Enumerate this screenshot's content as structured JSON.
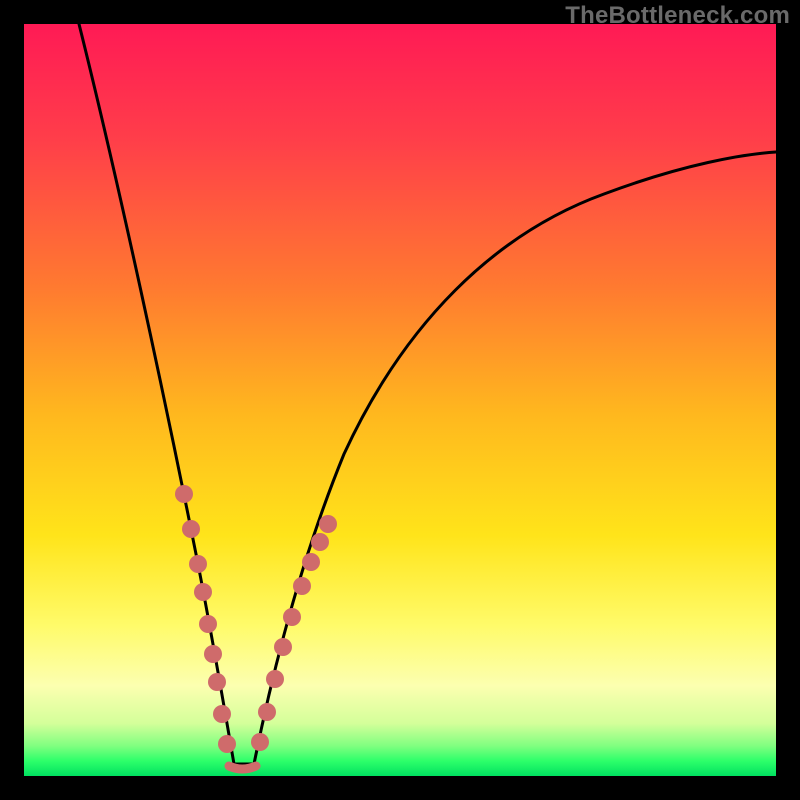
{
  "watermark": "TheBottleneck.com",
  "chart_data": {
    "type": "line",
    "title": "",
    "xlabel": "",
    "ylabel": "",
    "xlim": [
      0,
      100
    ],
    "ylim": [
      0,
      100
    ],
    "note": "Axes unlabeled; values inferred from pixel geometry on a 0–100 normalized scale for both axes. Curve is a V-shape with minimum near x≈28, rising steeply to the left and more gradually (with taper) to the right. Salmon markers cluster on both arms near the trough.",
    "series": [
      {
        "name": "curve",
        "x": [
          8,
          12,
          16,
          19,
          22,
          24,
          26,
          27,
          28,
          29,
          31,
          33,
          36,
          40,
          46,
          54,
          64,
          78,
          92,
          100
        ],
        "y": [
          100,
          83,
          65,
          50,
          36,
          25,
          14,
          7,
          1,
          1,
          7,
          17,
          28,
          40,
          52,
          62,
          70,
          77,
          81,
          83
        ]
      }
    ],
    "markers": {
      "name": "highlighted-points",
      "color": "#cf6b6b",
      "x": [
        21,
        22.5,
        24,
        24.6,
        25.3,
        26,
        26.6,
        27.3,
        28,
        28.8,
        29.6,
        30.5,
        31.3,
        32.2,
        33.4,
        34.7,
        35.5,
        36.3,
        37.2
      ],
      "y": [
        39,
        32,
        25,
        21,
        17,
        13,
        9,
        5,
        1,
        1,
        4,
        9,
        14,
        19,
        24,
        29,
        32,
        34,
        36
      ]
    }
  }
}
